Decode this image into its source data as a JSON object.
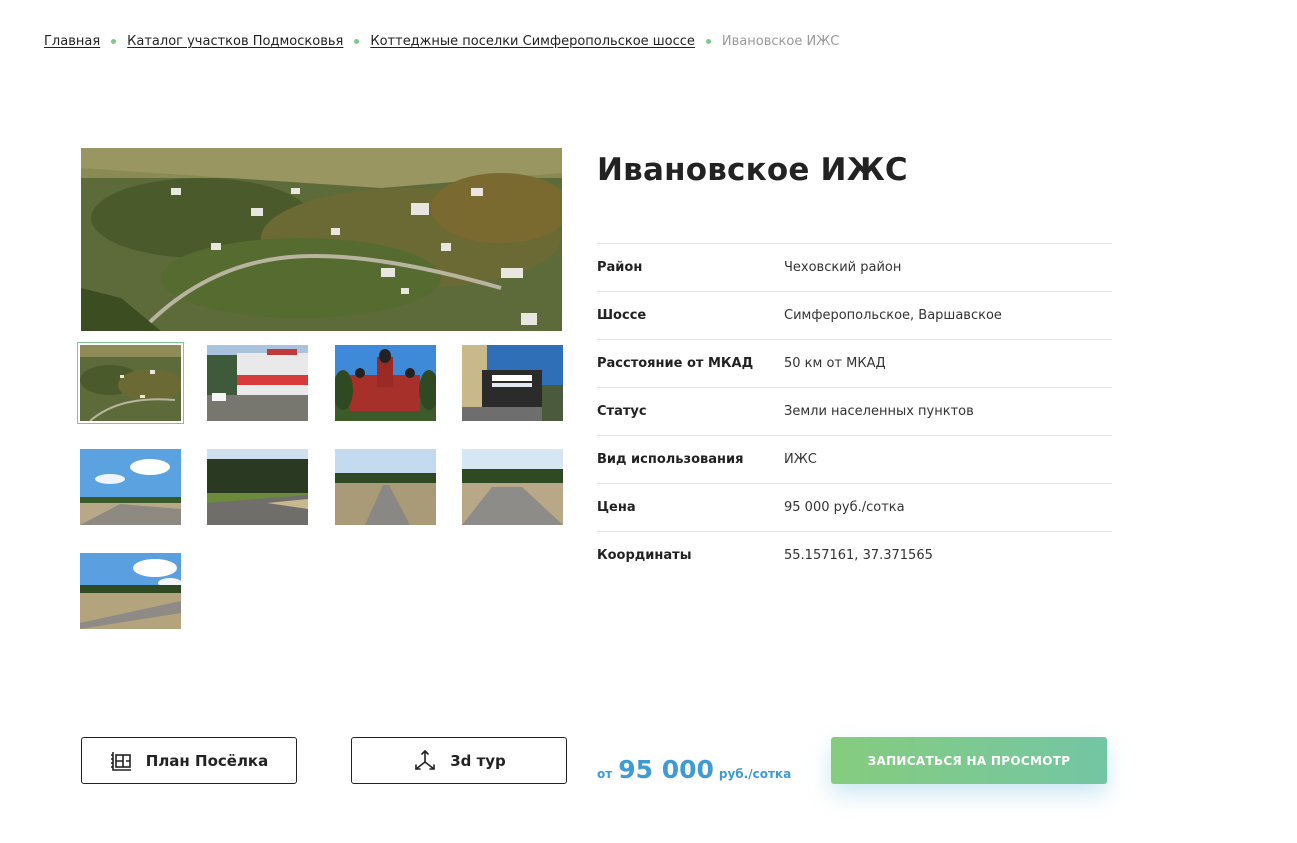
{
  "breadcrumb": {
    "items": [
      {
        "label": "Главная"
      },
      {
        "label": "Каталог участков Подмосковья"
      },
      {
        "label": "Коттеджные поселки Симферопольское шоссе"
      }
    ],
    "current": "Ивановское ИЖС"
  },
  "gallery": {
    "main_photo": "aerial-village-photo",
    "thumbnails": [
      {
        "scene": "aerial-village"
      },
      {
        "scene": "shop-building"
      },
      {
        "scene": "red-church"
      },
      {
        "scene": "sports-hall"
      },
      {
        "scene": "road-field"
      },
      {
        "scene": "road-forest"
      },
      {
        "scene": "road-field"
      },
      {
        "scene": "road-forest"
      },
      {
        "scene": "road-field"
      }
    ]
  },
  "title": "Ивановское ИЖС",
  "properties": [
    {
      "key": "Район",
      "value": "Чеховский район"
    },
    {
      "key": "Шоссе",
      "value": "Симферопольское, Варшавское"
    },
    {
      "key": "Расстояние от МКАД",
      "value": "50 км от МКАД"
    },
    {
      "key": "Статус",
      "value": "Земли населенных пунктов"
    },
    {
      "key": "Вид использования",
      "value": "ИЖС"
    },
    {
      "key": "Цена",
      "value": "95 000 руб./сотка"
    },
    {
      "key": "Координаты",
      "value": "55.157161, 37.371565"
    }
  ],
  "actions": {
    "plan_label": "План Посёлка",
    "tour_label": "3d тур",
    "price_prefix": "от",
    "price_value": "95 000",
    "price_unit": "руб./сотка",
    "cta_label": "ЗАПИСАТЬСЯ НА ПРОСМОТР"
  },
  "colors": {
    "accent_green": "#7cc98f",
    "price_blue": "#3f9bd6",
    "cta_gradient_start": "#86cc7e",
    "cta_gradient_end": "#73c6a4"
  }
}
